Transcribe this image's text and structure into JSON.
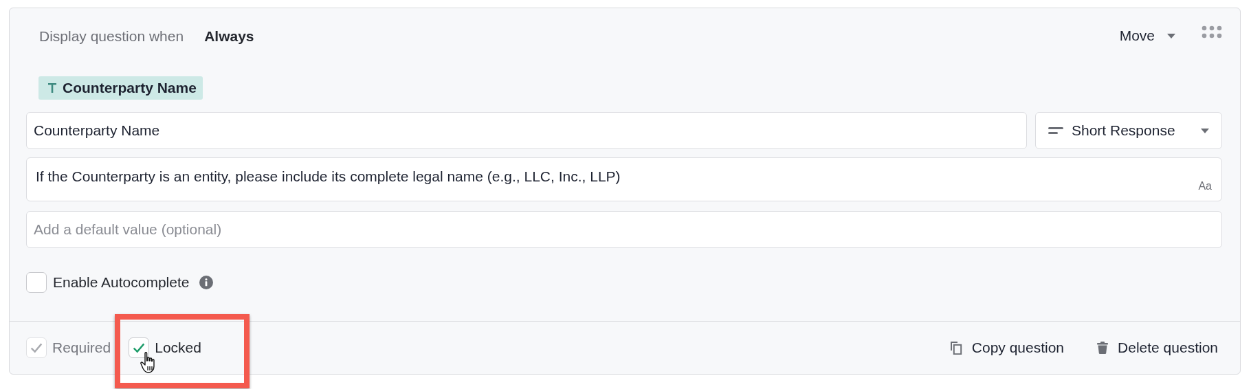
{
  "display_rule": {
    "label": "Display question when",
    "value": "Always"
  },
  "move_menu": {
    "label": "Move"
  },
  "variable_tag": {
    "label": "Counterparty Name"
  },
  "question_field": {
    "value": "Counterparty Name"
  },
  "response_type": {
    "label": "Short Response"
  },
  "description_field": {
    "value": "If the Counterparty is an entity, please include its complete legal name (e.g., LLC, Inc., LLP)",
    "format_label": "Aa"
  },
  "default_field": {
    "placeholder": "Add a default value (optional)"
  },
  "options": [
    {
      "label": "Enable Autocomplete",
      "checked": false,
      "disabled": false,
      "info": true
    }
  ],
  "footer_checks": [
    {
      "label": "Required",
      "checked": true,
      "disabled": true,
      "highlighted": false
    },
    {
      "label": "Locked",
      "checked": true,
      "disabled": false,
      "highlighted": true
    }
  ],
  "actions": [
    {
      "kind": "copy",
      "label": "Copy question"
    },
    {
      "kind": "delete",
      "label": "Delete question"
    }
  ]
}
